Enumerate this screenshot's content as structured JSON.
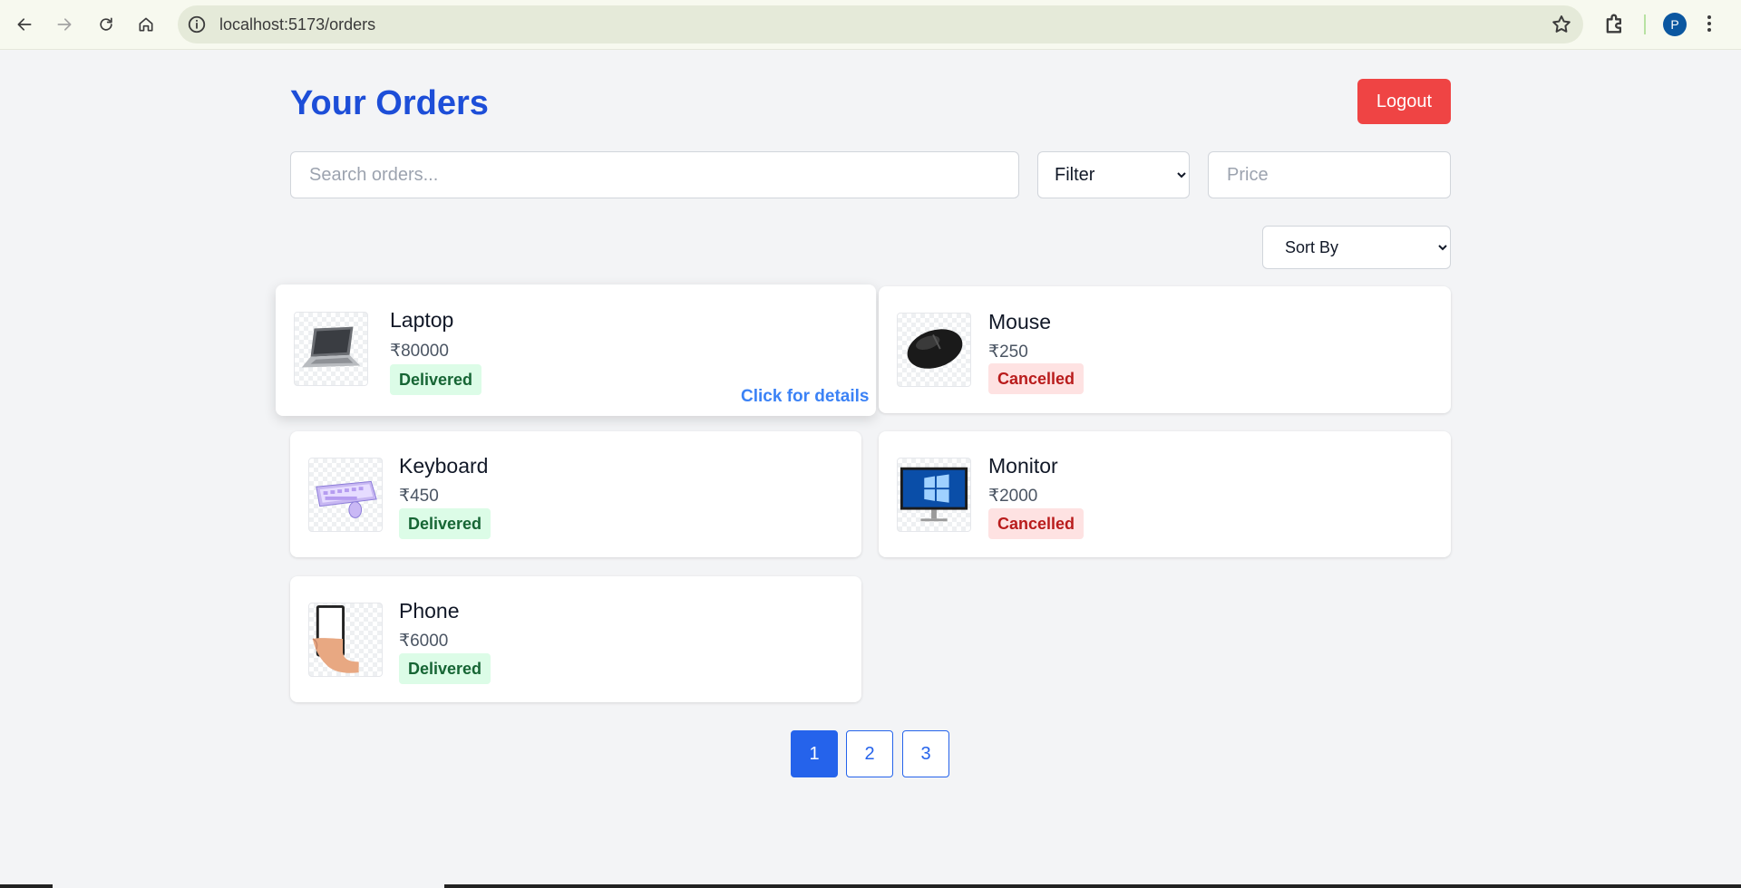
{
  "browser": {
    "url": "localhost:5173/orders",
    "avatar_letter": "P"
  },
  "page": {
    "title": "Your Orders",
    "logout_label": "Logout"
  },
  "filters": {
    "search_placeholder": "Search orders...",
    "filter_selected": "Filter",
    "price_placeholder": "Price",
    "sort_selected": "Sort By"
  },
  "orders": [
    {
      "name": "Laptop",
      "price": "₹80000",
      "status": "Delivered",
      "icon": "laptop-icon",
      "details_label": "Click for details"
    },
    {
      "name": "Mouse",
      "price": "₹250",
      "status": "Cancelled",
      "icon": "mouse-icon"
    },
    {
      "name": "Keyboard",
      "price": "₹450",
      "status": "Delivered",
      "icon": "keyboard-icon"
    },
    {
      "name": "Monitor",
      "price": "₹2000",
      "status": "Cancelled",
      "icon": "monitor-icon"
    },
    {
      "name": "Phone",
      "price": "₹6000",
      "status": "Delivered",
      "icon": "phone-icon"
    }
  ],
  "pagination": {
    "pages": [
      "1",
      "2",
      "3"
    ],
    "current": "1"
  },
  "colors": {
    "title": "#1d4ed8",
    "logout": "#ef4444",
    "delivered_bg": "#dcfce7",
    "delivered_text": "#166534",
    "cancelled_bg": "#fee2e2",
    "cancelled_text": "#b91c1c",
    "pagination_active": "#2563eb"
  }
}
